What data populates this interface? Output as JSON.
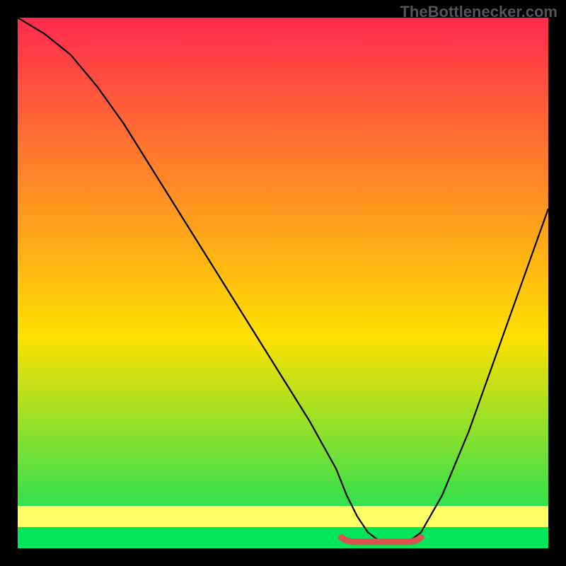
{
  "watermark": "TheBottlenecker.com",
  "chart_data": {
    "type": "line",
    "title": "",
    "xlabel": "",
    "ylabel": "",
    "xlim": [
      0,
      100
    ],
    "ylim": [
      0,
      100
    ],
    "bg_gradient": {
      "top": "#ff2a4f",
      "mid": "#ffe000",
      "bottom": "#00e060"
    },
    "curve": {
      "x": [
        0,
        5,
        10,
        15,
        20,
        25,
        30,
        35,
        40,
        45,
        50,
        55,
        60,
        62,
        64,
        66,
        68,
        70,
        72,
        74,
        76,
        80,
        85,
        90,
        95,
        100
      ],
      "y": [
        100,
        97,
        93,
        87,
        80,
        72,
        64,
        56,
        48,
        40,
        32,
        24,
        15,
        10,
        6,
        3,
        1.5,
        1,
        1,
        1.5,
        3,
        10,
        22,
        36,
        50,
        64
      ]
    },
    "green_band": {
      "y0": 0,
      "y1": 4
    },
    "yellow_band": {
      "y0": 4,
      "y1": 8
    },
    "marker_band": {
      "x0": 61,
      "x1": 76,
      "y": 1.5,
      "color": "#d9534f"
    }
  }
}
